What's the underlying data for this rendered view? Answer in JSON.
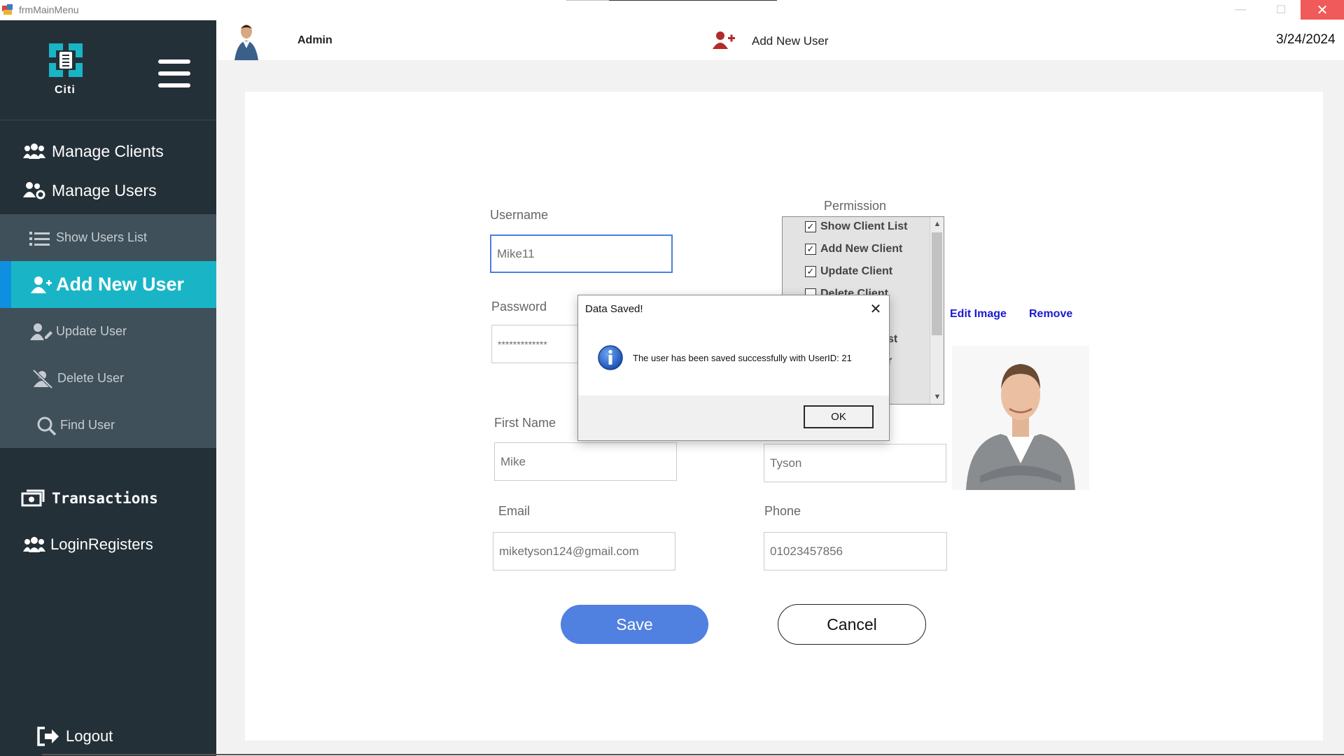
{
  "window": {
    "title": "frmMainMenu",
    "minimize_label": "—",
    "maximize_label": "☐",
    "close_label": "✕"
  },
  "sidebar": {
    "logo_text": "Citi",
    "items": [
      {
        "label": "Manage Clients",
        "icon": "clients-icon"
      },
      {
        "label": "Manage Users",
        "icon": "users-gear-icon"
      },
      {
        "label": "Show Users List",
        "icon": "list-icon"
      },
      {
        "label": "Add New User",
        "icon": "user-plus-icon"
      },
      {
        "label": "Update User",
        "icon": "user-edit-icon"
      },
      {
        "label": "Delete User",
        "icon": "user-delete-icon"
      },
      {
        "label": "Find User",
        "icon": "search-icon"
      },
      {
        "label": "Transactions",
        "icon": "money-icon"
      },
      {
        "label": "LoginRegisters",
        "icon": "clients-icon"
      }
    ],
    "logout_label": "Logout"
  },
  "topbar": {
    "user_name": "Admin",
    "page_title": "Add New User",
    "date": "3/24/2024"
  },
  "form": {
    "username_label": "Username",
    "username_value": "Mike11",
    "password_label": "Password",
    "password_value": "*************",
    "permission_label": "Permission",
    "permissions": [
      {
        "label": "Show Client List",
        "checked": true
      },
      {
        "label": "Add New Client",
        "checked": true
      },
      {
        "label": "Update Client",
        "checked": true
      },
      {
        "label": "Delete Client",
        "checked": false
      }
    ],
    "hidden_fragments": [
      "st",
      "r"
    ],
    "edit_image_label": "Edit Image",
    "remove_label": "Remove",
    "first_name_label": "First Name",
    "first_name_value": "Mike",
    "last_name_value": "Tyson",
    "email_label": "Email",
    "email_value": "miketyson124@gmail.com",
    "phone_label": "Phone",
    "phone_value": "01023457856",
    "save_label": "Save",
    "cancel_label": "Cancel"
  },
  "dialog": {
    "title": "Data Saved!",
    "message": "The user has been saved successfully with UserID: 21",
    "ok_label": "OK",
    "close_label": "✕"
  },
  "colors": {
    "sidebar_bg": "#243038",
    "submenu_bg": "#3f505a",
    "active_bg": "#19b5c6",
    "save_button": "#5080e0",
    "link": "#1a1ad0"
  }
}
